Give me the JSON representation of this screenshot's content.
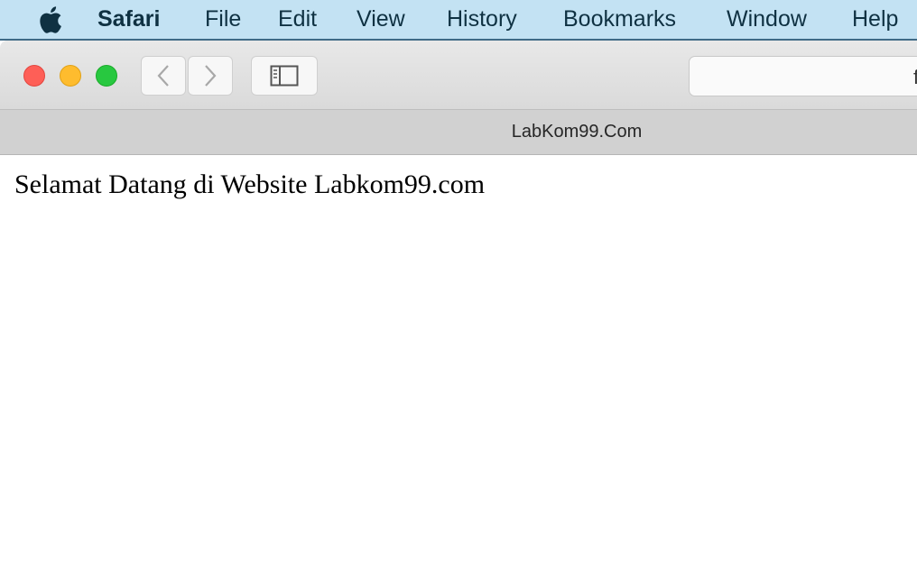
{
  "menubar": {
    "items": [
      "Safari",
      "File",
      "Edit",
      "View",
      "History",
      "Bookmarks",
      "Window",
      "Help"
    ]
  },
  "toolbar": {
    "address_text": "f"
  },
  "tab": {
    "title": "LabKom99.Com"
  },
  "page": {
    "text": "Selamat Datang di Website Labkom99.com"
  },
  "colors": {
    "close": "#fe5f57",
    "minimize": "#febc2e",
    "zoom": "#28c840",
    "menubar": "#c3e2f3"
  },
  "icons": [
    "apple-icon",
    "chevron-left-icon",
    "chevron-right-icon",
    "sidebar-icon"
  ]
}
